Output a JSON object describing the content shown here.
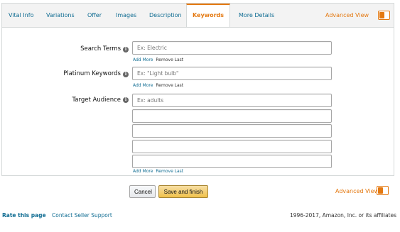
{
  "tabs": [
    {
      "label": "Vital Info",
      "active": false
    },
    {
      "label": "Variations",
      "active": false
    },
    {
      "label": "Offer",
      "active": false
    },
    {
      "label": "Images",
      "active": false
    },
    {
      "label": "Description",
      "active": false
    },
    {
      "label": "Keywords",
      "active": true
    },
    {
      "label": "More Details",
      "active": false
    }
  ],
  "advanced_view_label": "Advanced View",
  "advanced_view_on": true,
  "fields": {
    "search_terms": {
      "label": "Search Terms",
      "placeholder": "Ex: Electric",
      "value": ""
    },
    "platinum_keywords": {
      "label": "Platinum Keywords",
      "placeholder": "Ex: \"Light bulb\"",
      "value": ""
    },
    "target_audience": {
      "label": "Target Audience",
      "placeholder": "Ex: adults",
      "value": ""
    }
  },
  "info_glyph": "i",
  "add_more_label": "Add More",
  "remove_last_label": "Remove Last",
  "buttons": {
    "cancel": "Cancel",
    "save": "Save and finish"
  },
  "footer": {
    "rate": "Rate this page",
    "support": "Contact Seller Support",
    "copyright": "1996-2017, Amazon, Inc. or its affiliates"
  },
  "colors": {
    "accent": "#e47911",
    "link": "#0f6c92",
    "save_button": "#f0c14b"
  }
}
